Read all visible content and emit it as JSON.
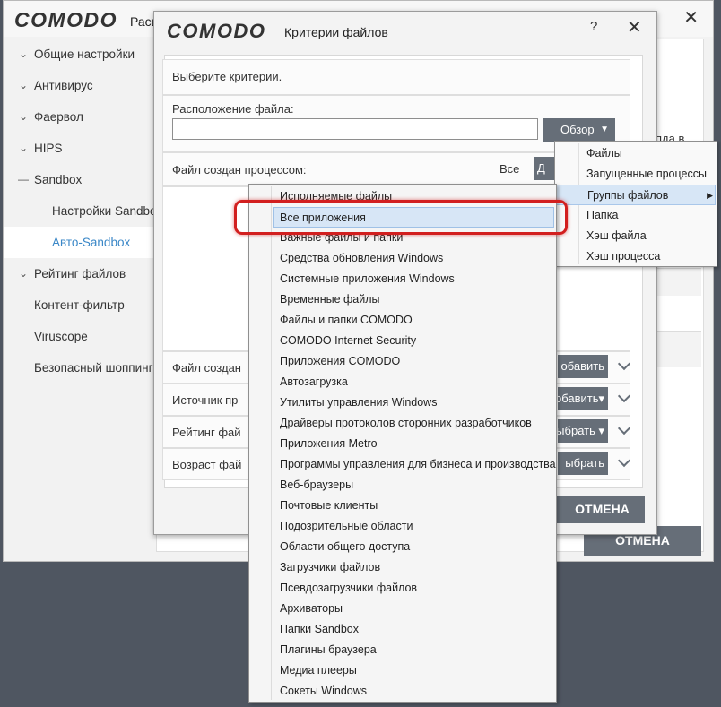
{
  "main_window": {
    "logo": "COMODO",
    "title": "Расш",
    "close": "✕",
    "sidebar": [
      {
        "mark": "chevron",
        "label": "Общие настройки"
      },
      {
        "mark": "chevron",
        "label": "Антивирус"
      },
      {
        "mark": "chevron",
        "label": "Фаервол"
      },
      {
        "mark": "chevron",
        "label": "HIPS"
      },
      {
        "mark": "dash",
        "label": "Sandbox"
      },
      {
        "mark": "",
        "label": "Настройки Sandbox"
      },
      {
        "mark": "",
        "label": "Авто-Sandbox",
        "active": true
      },
      {
        "mark": "chevron",
        "label": "Рейтинг файлов"
      },
      {
        "mark": "",
        "label": "Контент-фильтр"
      },
      {
        "mark": "",
        "label": "Viruscope"
      },
      {
        "mark": "",
        "label": "Безопасный шоппинг"
      }
    ],
    "partial_text": "пда в",
    "cancel_label": "ОТМЕНА"
  },
  "dialog": {
    "logo": "COMODO",
    "title": "Критерии файлов",
    "help": "?",
    "close": "✕",
    "choose_criteria": "Выберите критерии.",
    "file_location_label": "Расположение файла:",
    "file_location_value": "",
    "browse_label": "Обзор",
    "browse_arrow": "▼",
    "created_by_process_label": "Файл создан процессом:",
    "all_label": "Все",
    "d_button": "Д",
    "rows": [
      {
        "label": "Файл создан",
        "button": "обавить"
      },
      {
        "label": "Источник пр",
        "button": "обавить▾"
      },
      {
        "label": "Рейтинг фай",
        "button": "ыбрать ▾"
      },
      {
        "label": "Возраст фай",
        "button": "ыбрать"
      }
    ],
    "cancel_label": "ОТМЕНА"
  },
  "browse_menu": {
    "items": [
      {
        "label": "Файлы"
      },
      {
        "label": "Запущенные процессы"
      },
      {
        "label": "Группы файлов",
        "highlighted": true,
        "submenu": "▶"
      },
      {
        "label": "Папка"
      },
      {
        "label": "Хэш файла"
      },
      {
        "label": "Хэш процесса"
      }
    ]
  },
  "file_groups_menu": {
    "items": [
      "Исполняемые файлы",
      "Все приложения",
      "Важные файлы и папки",
      "Средства обновления Windows",
      "Системные приложения Windows",
      "Временные файлы",
      "Файлы и папки COMODO",
      "COMODO Internet Security",
      "Приложения COMODO",
      "Автозагрузка",
      "Утилиты управления Windows",
      "Драйверы протоколов сторонних разработчиков",
      "Приложения Metro",
      "Программы управления для бизнеса и производства",
      "Веб-браузеры",
      "Почтовые клиенты",
      "Подозрительные области",
      "Области общего доступа",
      "Загрузчики файлов",
      "Псевдозагрузчики файлов",
      "Архиваторы",
      "Папки Sandbox",
      "Плагины браузера",
      "Медиа плееры",
      "Сокеты Windows"
    ],
    "highlighted_index": 1
  },
  "colors": {
    "background": "#4f5661",
    "button_dark": "#666e78",
    "active_link": "#3a87c7",
    "menu_highlight": "#d7e6f6",
    "annotation_red": "#d21f1f"
  }
}
